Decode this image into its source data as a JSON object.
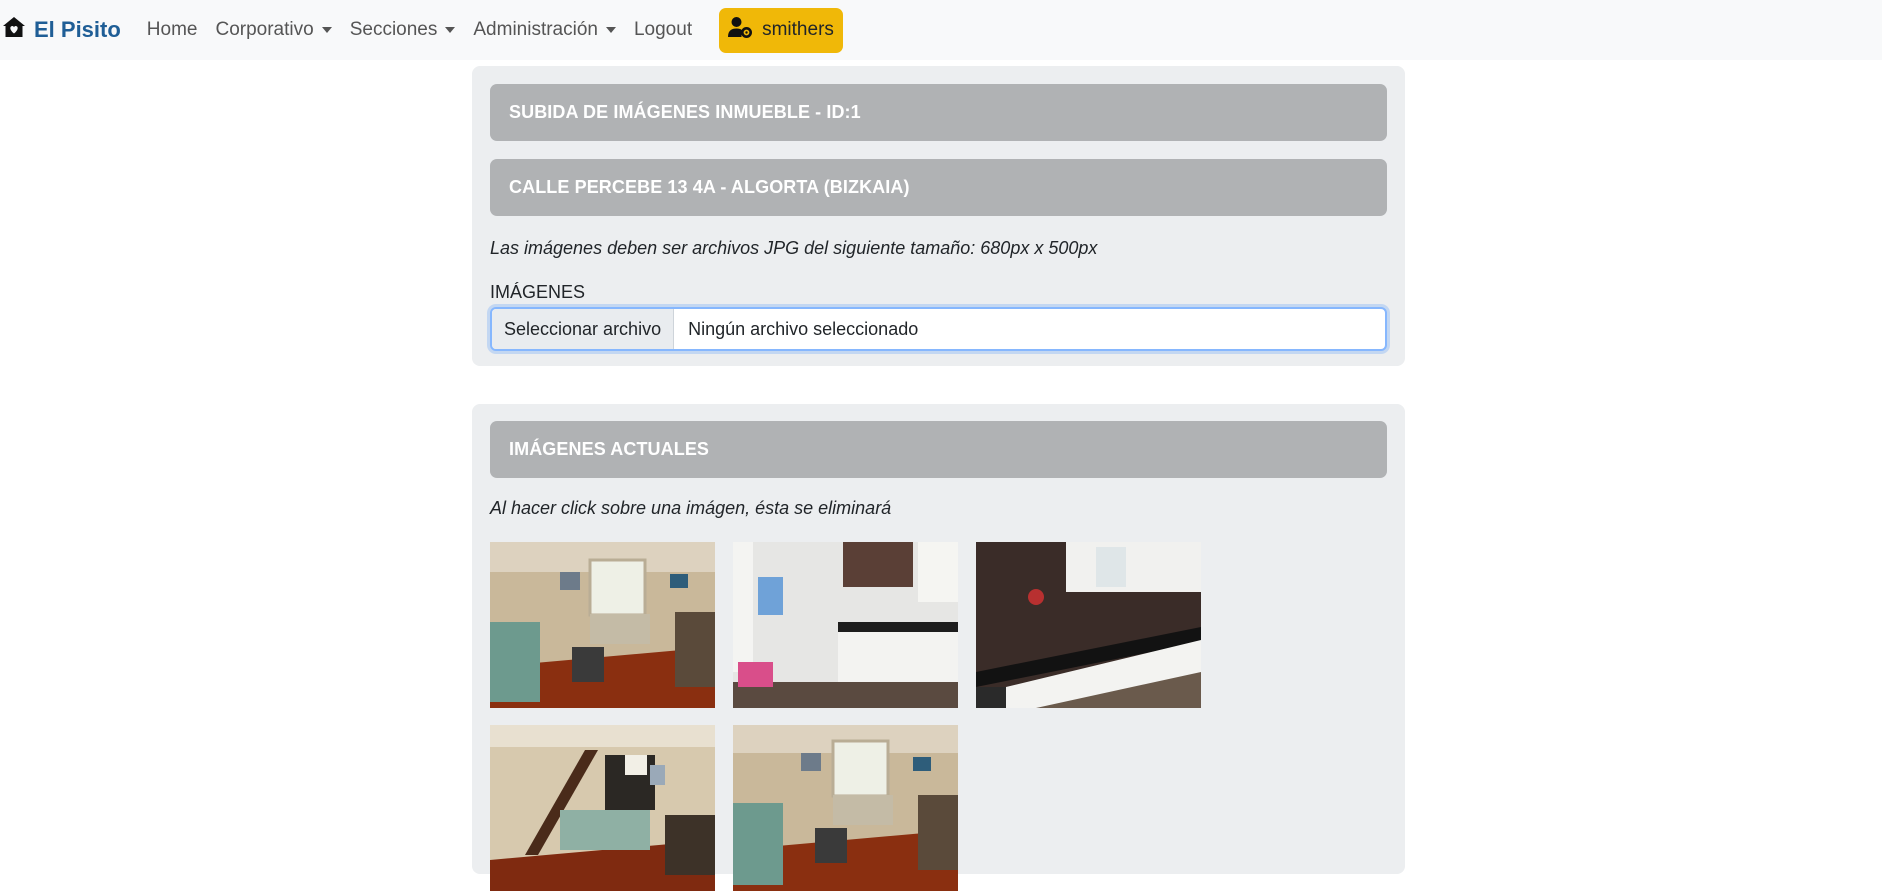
{
  "navbar": {
    "brand": "El Pisito",
    "brand_icon": "house-icon",
    "links": [
      {
        "label": "Home",
        "dropdown": false
      },
      {
        "label": "Corporativo",
        "dropdown": true
      },
      {
        "label": "Secciones",
        "dropdown": true
      },
      {
        "label": "Administración",
        "dropdown": true
      },
      {
        "label": "Logout",
        "dropdown": false
      }
    ],
    "user": {
      "name": "smithers",
      "icon": "user-gear-icon",
      "color": "#f0b808"
    },
    "brand_color": "#1f5e96"
  },
  "upload": {
    "header_title": "SUBIDA DE IMÁGENES INMUEBLE - ID:1",
    "address": "CALLE PERCEBE 13 4A - ALGORTA (BIZKAIA)",
    "note": "Las imágenes deben ser archivos JPG del siguiente tamaño: 680px x 500px",
    "field_label": "IMÁGENES",
    "file_button": "Seleccionar archivo",
    "file_status": "Ningún archivo seleccionado"
  },
  "current": {
    "header_title": "IMÁGENES ACTUALES",
    "note": "Al hacer click sobre una imágen, ésta se eliminará",
    "images": [
      {
        "alt": "living-room-photo"
      },
      {
        "alt": "kitchen-photo"
      },
      {
        "alt": "kitchen-photo"
      },
      {
        "alt": "staircase-living-room-photo"
      },
      {
        "alt": "living-room-photo"
      }
    ]
  },
  "colors": {
    "header_bg": "#b0b2b4",
    "panel_bg": "#eceef0",
    "focus_border": "#86b7fe"
  }
}
